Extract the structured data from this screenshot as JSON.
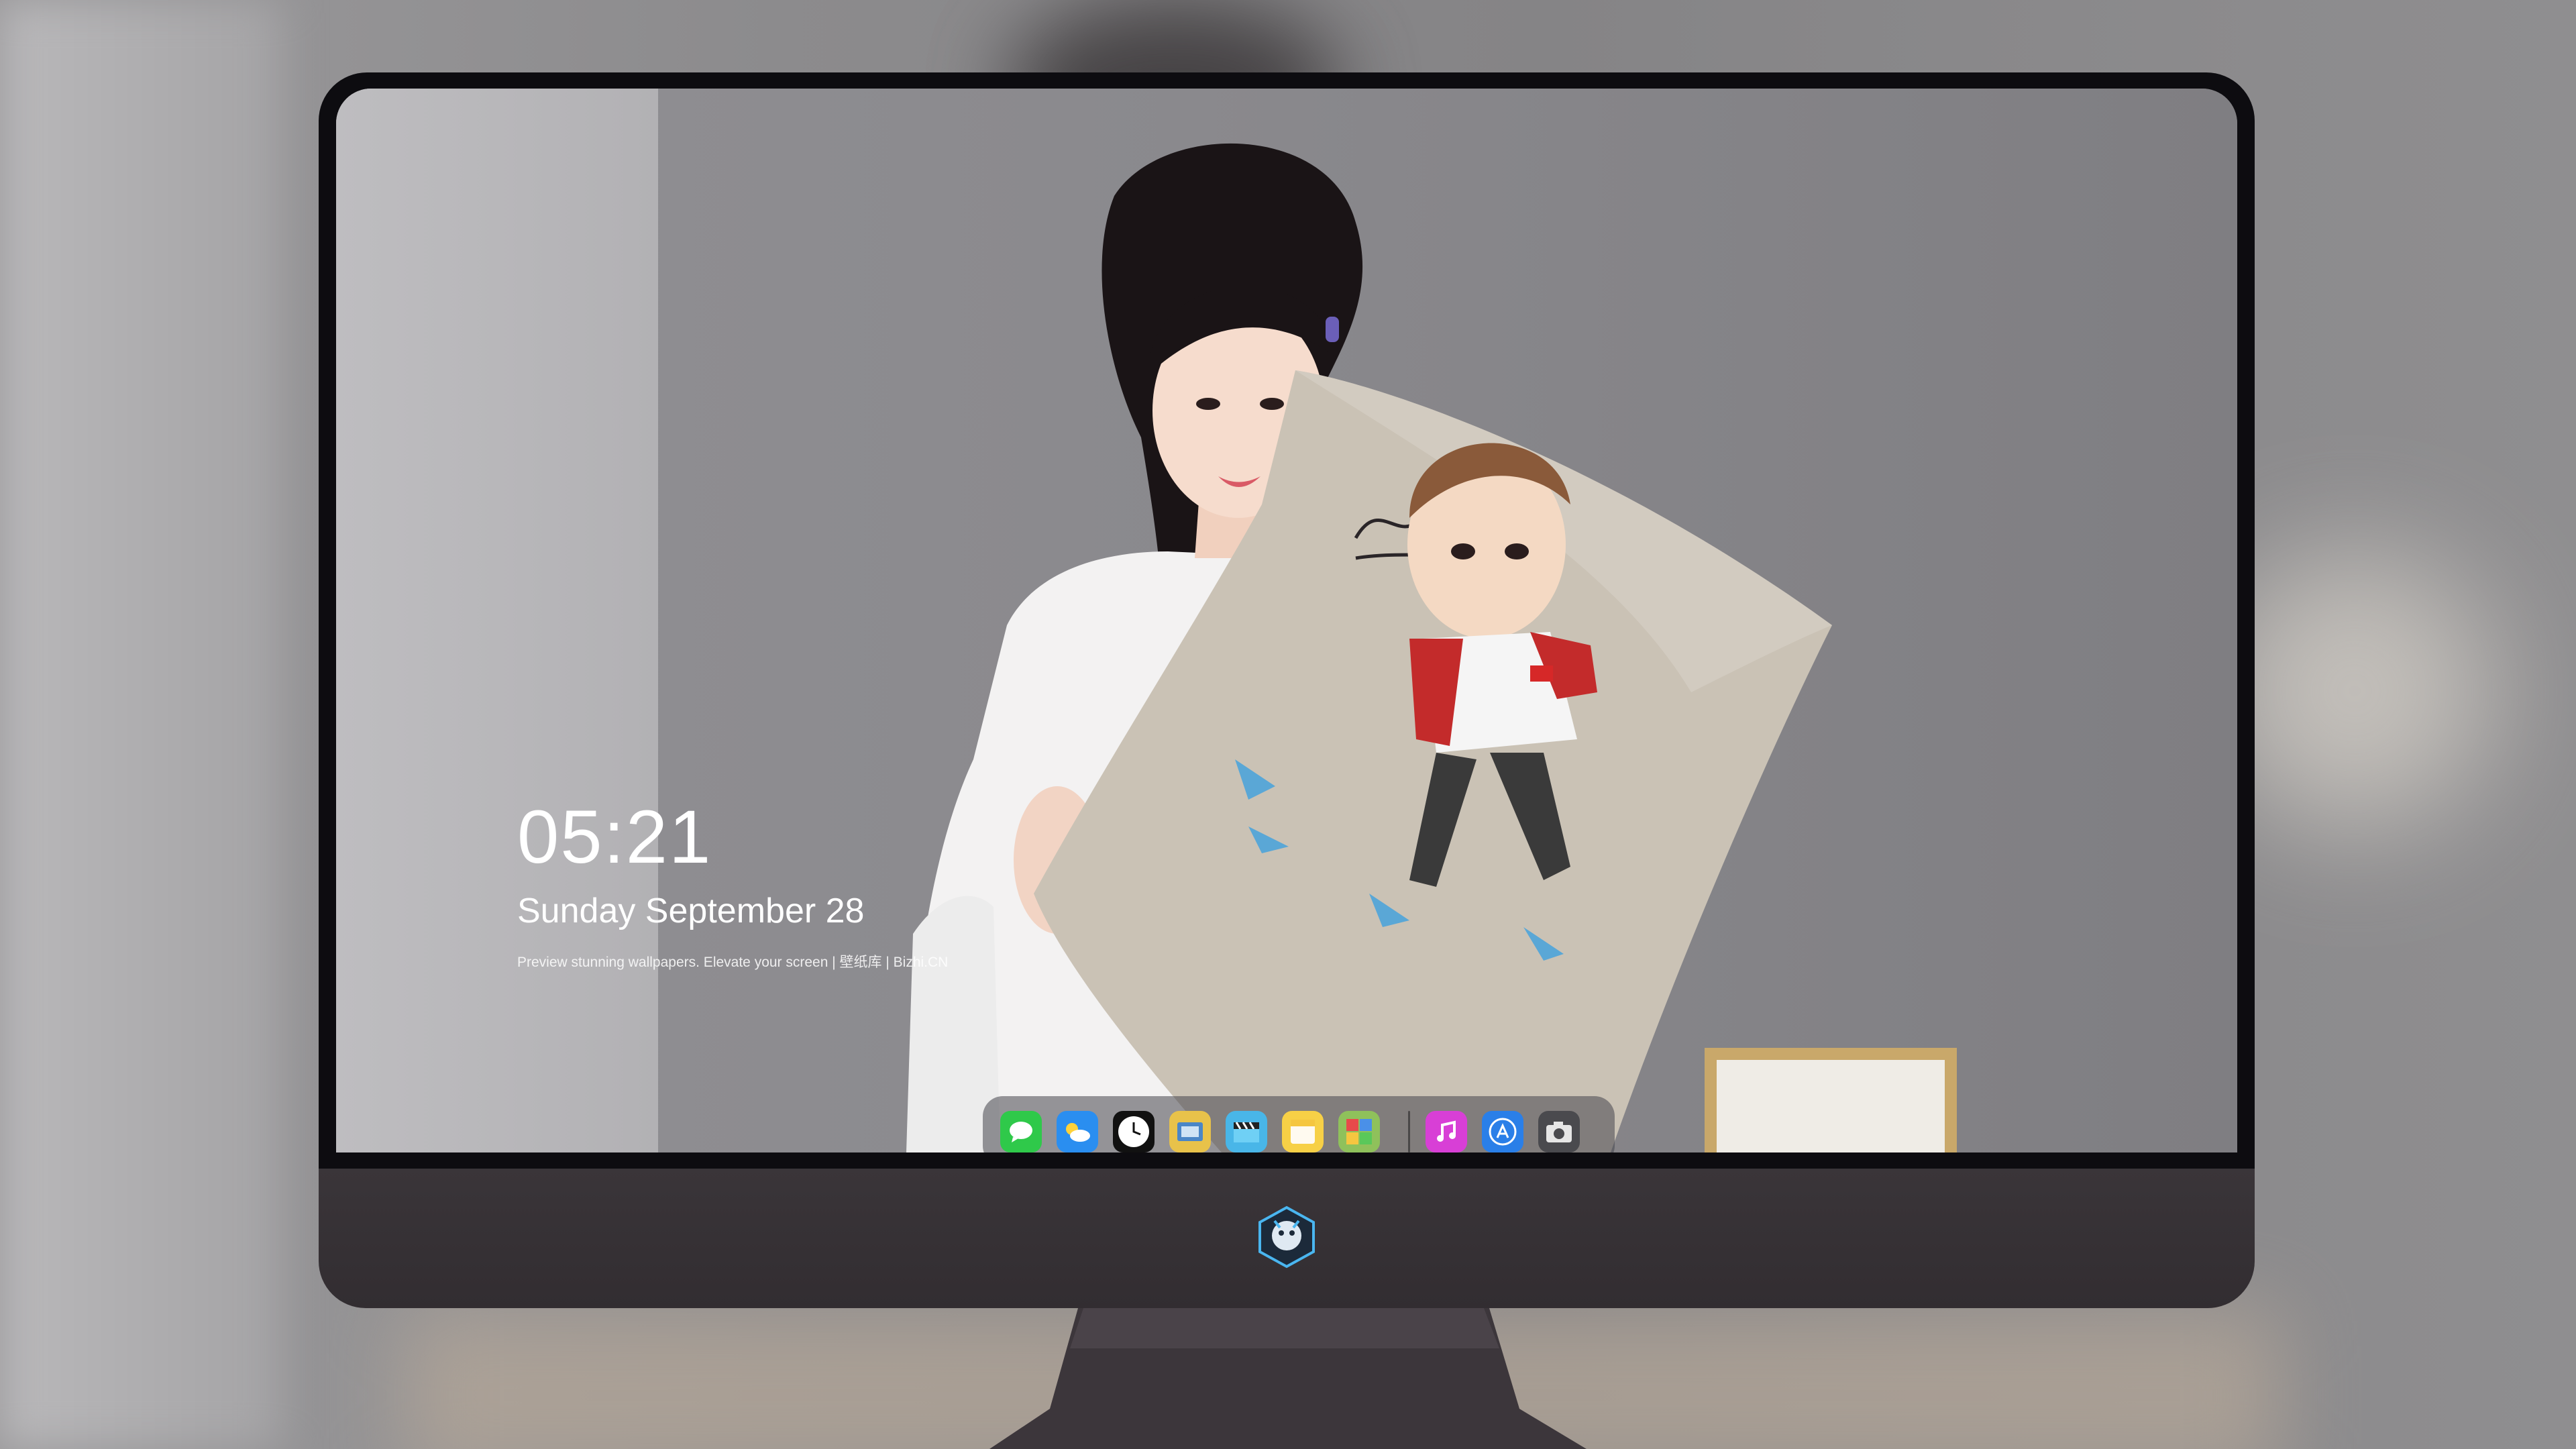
{
  "desktop": {
    "time": "05:21",
    "date": "Sunday September 28",
    "note": "Preview stunning wallpapers. Elevate your screen | 壁纸库 | Bizhi.CN"
  },
  "dock": {
    "apps": [
      {
        "name": "Messages",
        "icon": "messages-icon",
        "color": "#2fc94a"
      },
      {
        "name": "Weather",
        "icon": "weather-icon",
        "color": "#2a8ef0"
      },
      {
        "name": "Clock",
        "icon": "clock-icon",
        "color": "#111111"
      },
      {
        "name": "Preview",
        "icon": "preview-icon",
        "color": "#e8c24a"
      },
      {
        "name": "Final Cut",
        "icon": "clapper-icon",
        "color": "#49b6e8"
      },
      {
        "name": "Notes",
        "icon": "notes-icon",
        "color": "#f7d046"
      },
      {
        "name": "Photo Booth",
        "icon": "photos-icon",
        "color": "#8fc15b"
      },
      {
        "name": "iTunes",
        "icon": "music-icon",
        "color": "#d83fd6"
      },
      {
        "name": "App Store",
        "icon": "app-store-icon",
        "color": "#2a7fe8"
      },
      {
        "name": "Camera",
        "icon": "camera-icon",
        "color": "#4a4a4e"
      }
    ]
  },
  "colors": {
    "bezel": "#0d0c10",
    "chin": "#352f33",
    "dock_bg": "#46464c"
  }
}
